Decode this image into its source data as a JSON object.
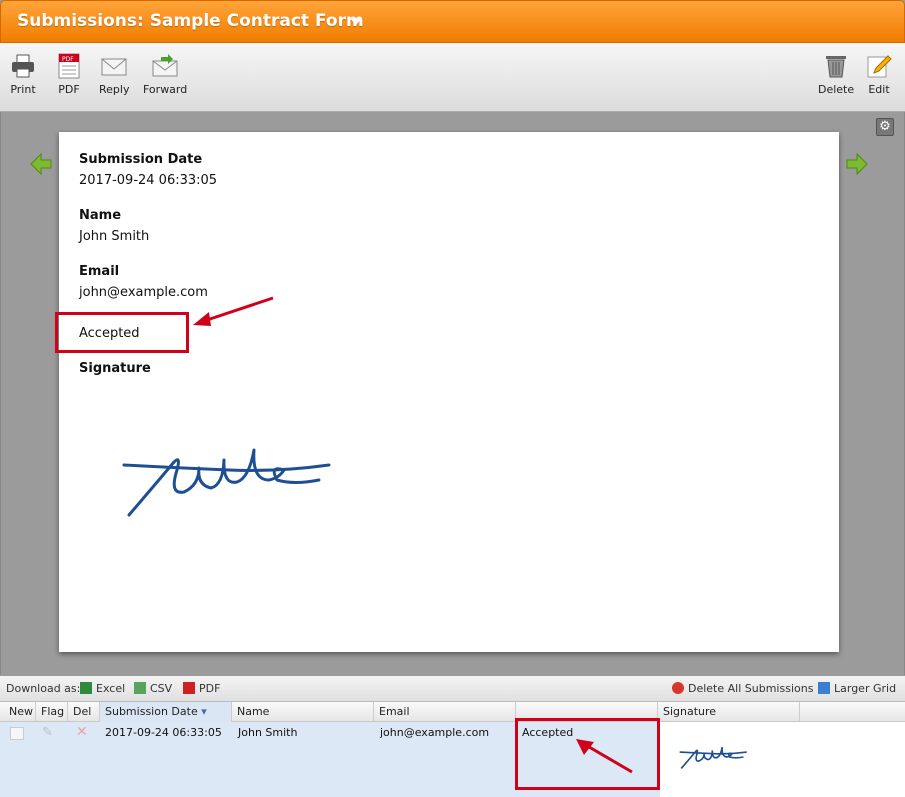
{
  "window": {
    "title": "Submissions: Sample Contract Form"
  },
  "toolbar": {
    "print": "Print",
    "pdf": "PDF",
    "pdf_badge": "PDF",
    "reply": "Reply",
    "forward": "Forward",
    "delete": "Delete",
    "edit": "Edit"
  },
  "submission": {
    "date_label": "Submission Date",
    "date_value": "2017-09-24 06:33:05",
    "name_label": "Name",
    "name_value": "John Smith",
    "email_label": "Email",
    "email_value": "john@example.com",
    "status_value": "Accepted",
    "signature_label": "Signature"
  },
  "grid_toolbar": {
    "download_as": "Download as:",
    "excel": "Excel",
    "csv": "CSV",
    "pdf": "PDF",
    "delete_all": "Delete All Submissions",
    "larger_grid": "Larger Grid"
  },
  "grid": {
    "columns": [
      "New",
      "Flag",
      "Del",
      "Submission Date",
      "Name",
      "Email",
      "",
      "Signature"
    ],
    "rows": [
      {
        "date": "2017-09-24 06:33:05",
        "name": "John Smith",
        "email": "john@example.com",
        "status": "Accepted"
      }
    ]
  },
  "colors": {
    "accent": "#f58a0b",
    "highlight": "#d0021b",
    "signature": "#1f4f93"
  }
}
